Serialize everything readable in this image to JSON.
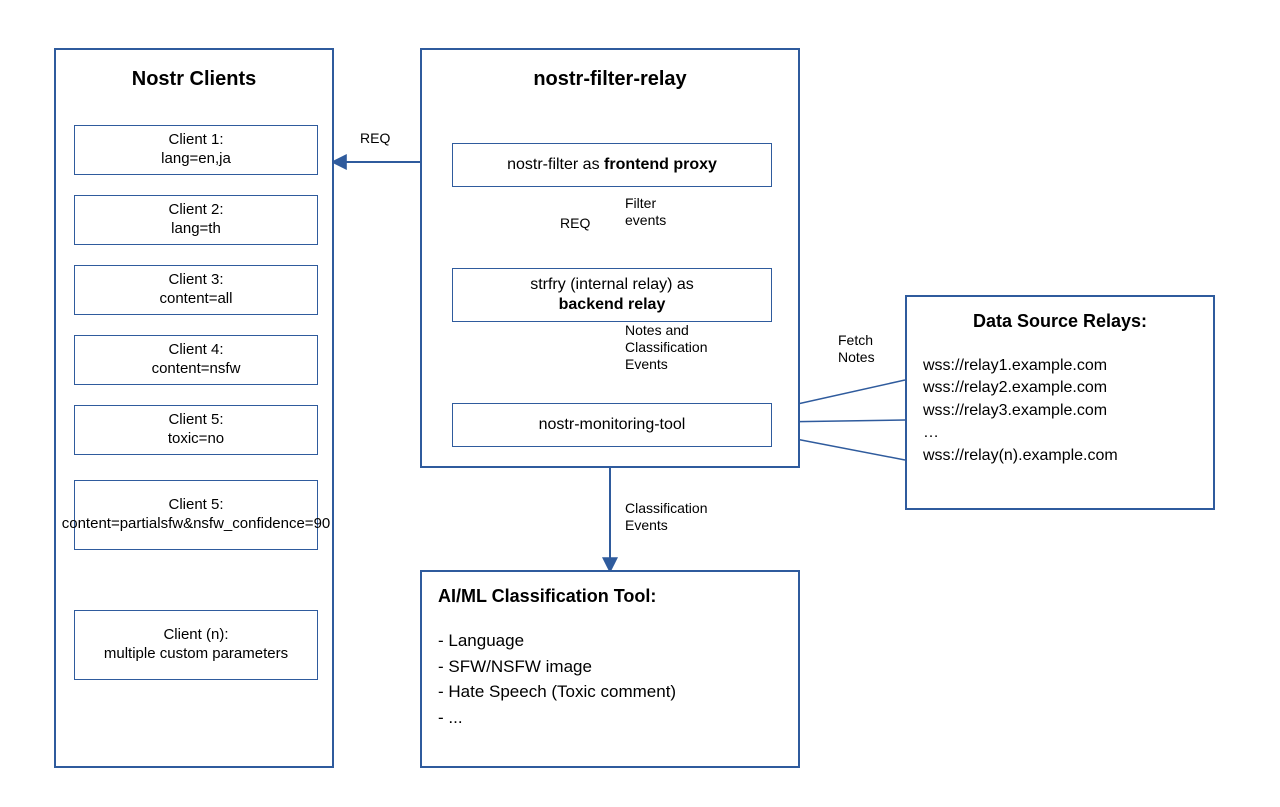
{
  "nostr_clients": {
    "title": "Nostr Clients",
    "items": [
      "Client 1:\nlang=en,ja",
      "Client 2:\nlang=th",
      "Client 3:\ncontent=all",
      "Client 4:\ncontent=nsfw",
      "Client 5:\ntoxic=no",
      "Client 5:\ncontent=partialsfw&nsfw_confidence=90",
      "Client (n):\nmultiple custom parameters"
    ]
  },
  "filter_relay": {
    "title": "nostr-filter-relay",
    "frontend_prefix": "nostr-filter as ",
    "frontend_bold": "frontend proxy",
    "backend_prefix": "strfry (internal relay) as",
    "backend_bold": "backend relay",
    "monitoring": "nostr-monitoring-tool"
  },
  "labels": {
    "req1": "REQ",
    "req2": "REQ",
    "filter_events": "Filter\nevents",
    "notes_class": "Notes and\nClassification\nEvents",
    "class_events": "Classification\nEvents",
    "fetch_notes": "Fetch\nNotes"
  },
  "data_source": {
    "title": "Data Source Relays:",
    "lines": "wss://relay1.example.com\nwss://relay2.example.com\nwss://relay3.example.com\n…\nwss://relay(n).example.com"
  },
  "aiml": {
    "title": "AI/ML Classification Tool:",
    "body": "- Language\n- SFW/NSFW image\n- Hate Speech (Toxic comment)\n- ..."
  },
  "colors": {
    "stroke": "#2f5b9d"
  }
}
